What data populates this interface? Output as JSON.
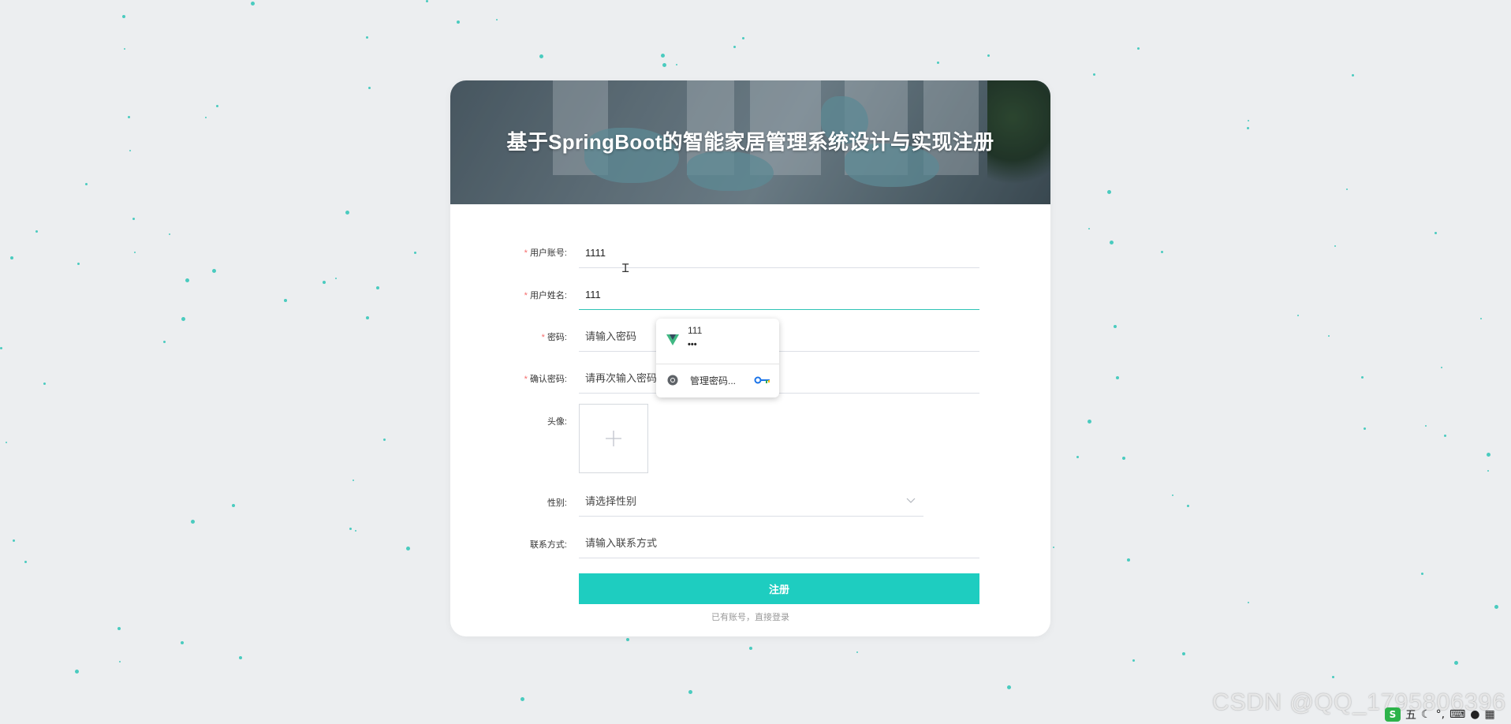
{
  "page": {
    "title": "基于SpringBoot的智能家居管理系统设计与实现注册"
  },
  "form": {
    "fields": [
      {
        "key": "account",
        "label": "用户账号:",
        "required": true,
        "value": "1111",
        "placeholder": ""
      },
      {
        "key": "username",
        "label": "用户姓名:",
        "required": true,
        "value": "111",
        "placeholder": ""
      },
      {
        "key": "password",
        "label": "密码:",
        "required": true,
        "value": "",
        "placeholder": "请输入密码"
      },
      {
        "key": "confirm",
        "label": "确认密码:",
        "required": true,
        "value": "",
        "placeholder": "请再次输入密码"
      }
    ],
    "required_mark": "*",
    "avatar": {
      "label": "头像:"
    },
    "gender": {
      "label": "性别:",
      "placeholder": "请选择性别"
    },
    "contact": {
      "label": "联系方式:",
      "placeholder": "请输入联系方式"
    },
    "submit_label": "注册",
    "login_link": "已有账号，直接登录"
  },
  "autofill_popup": {
    "suggestion_user": "111",
    "suggestion_password": "•••",
    "manage_label": "管理密码..."
  },
  "watermark": "CSDN @QQ_1795806396",
  "ime_bar": {
    "mode": "五"
  },
  "colors": {
    "accent": "#1ecdc0",
    "required": "#f56c6c",
    "page_background": "#eceef0"
  },
  "icons": [
    "plus-icon",
    "chevron-down-icon",
    "vue-icon",
    "chrome-icon",
    "key-icon",
    "text-cursor-icon"
  ]
}
